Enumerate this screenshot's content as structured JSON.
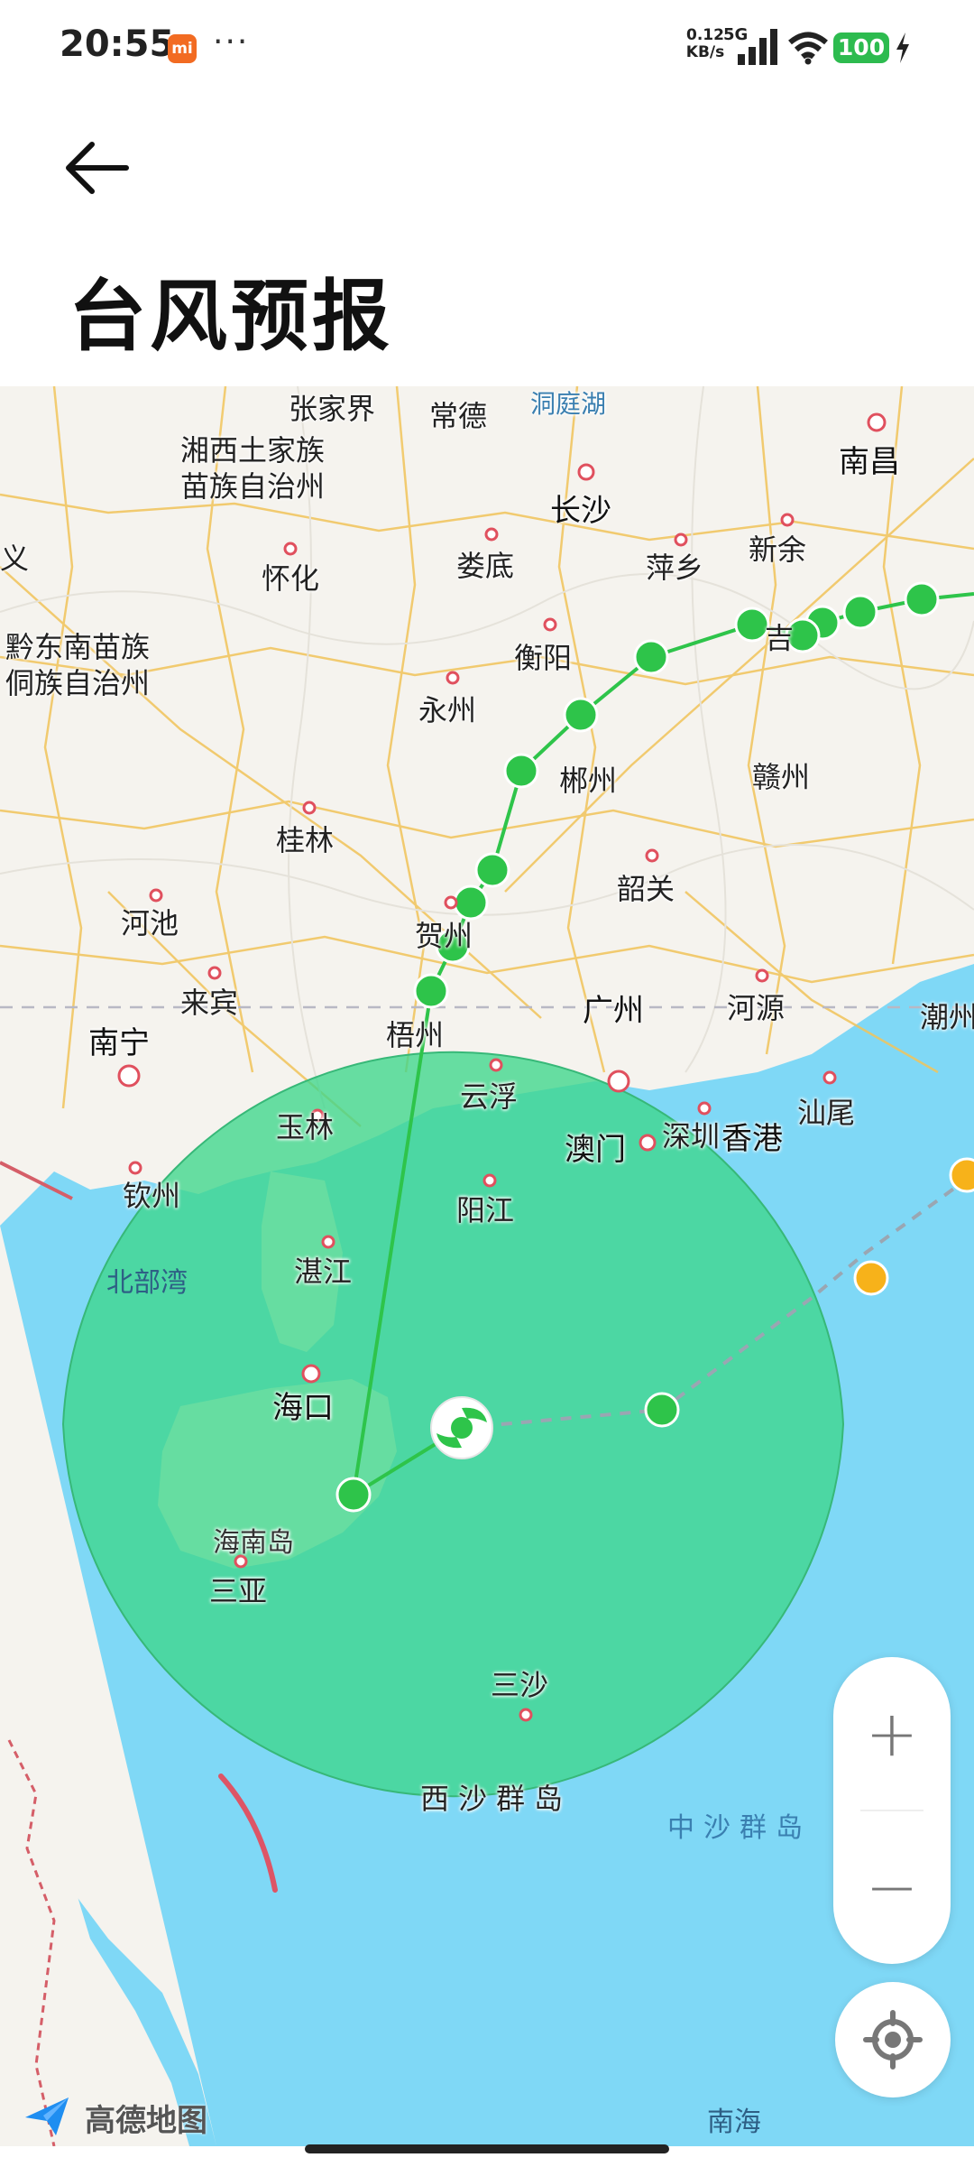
{
  "status_bar": {
    "time": "20:55",
    "app_badge": "mi",
    "more": "···",
    "speed_value": "0.12",
    "speed_unit": "KB/s",
    "network": "5G",
    "battery": "100"
  },
  "header": {
    "title": "台风预报"
  },
  "map": {
    "labels": {
      "zhangjiajie": "张家界",
      "changde": "常德",
      "dongtinghu": "洞庭湖",
      "xiangxi_1": "湘西土家族",
      "xiangxi_2": "苗族自治州",
      "changsha": "长沙",
      "nanchang": "南昌",
      "yi": "义",
      "huaihua": "怀化",
      "loudi": "娄底",
      "pingxiang": "萍乡",
      "xinyu": "新余",
      "qiandongnan_1": "黔东南苗族",
      "qiandongnan_2": "侗族自治州",
      "hengyang": "衡阳",
      "ji": "吉",
      "yongzhou": "永州",
      "chenzhou": "郴州",
      "ganzhou": "赣州",
      "guilin": "桂林",
      "shaoguan": "韶关",
      "hechi": "河池",
      "hezhou": "贺州",
      "laibin": "来宾",
      "guangzhou": "广州",
      "heyuan": "河源",
      "chaozhou": "潮州",
      "nanning": "南宁",
      "wuzhou": "梧州",
      "yunfu": "云浮",
      "yulin": "玉林",
      "macau": "澳门",
      "shenzhen": "深圳",
      "hongkong": "香港",
      "shanwei": "汕尾",
      "qinzhou": "钦州",
      "yangjiang": "阳江",
      "beibuwan": "北部湾",
      "zhanjiang": "湛江",
      "haikou": "海口",
      "hainandao": "海南岛",
      "sanya": "三亚",
      "sansha": "三沙",
      "xisha": "西沙群岛",
      "zhongsha": "中沙群岛",
      "nanhai": "南海"
    },
    "typhoon_marker": "typhoon-icon",
    "colors": {
      "sea": "#7fd8f6",
      "land": "#f5f3ee",
      "wind_circle": "#3dd68c",
      "track_past": "#2ec44a",
      "forecast_line": "#9aa6b2",
      "other_typhoon": "#f7b21a"
    }
  },
  "controls": {
    "zoom_in": "+",
    "zoom_out": "−",
    "locate_icon": "locate-icon"
  },
  "branding": {
    "logo": "高德地图"
  }
}
